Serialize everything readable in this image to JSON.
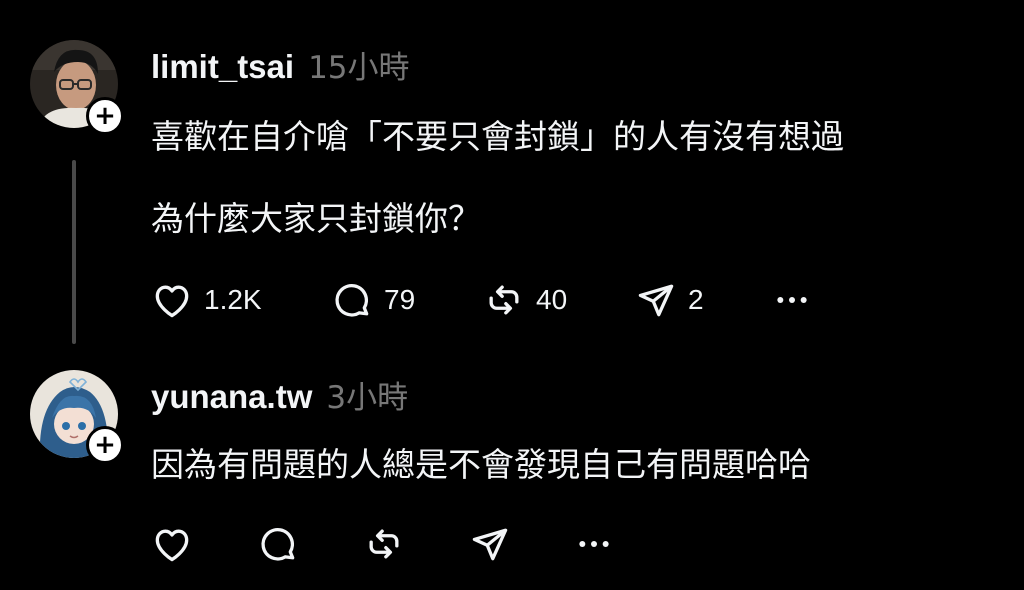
{
  "posts": [
    {
      "username": "limit_tsai",
      "time": "15小時",
      "lines": [
        "喜歡在自介嗆「不要只會封鎖」的人有沒有想過",
        "為什麼大家只封鎖你？"
      ],
      "counts": {
        "like": "1.2K",
        "reply": "79",
        "repost": "40",
        "share": "2"
      }
    },
    {
      "username": "yunana.tw",
      "time": "3小時",
      "lines": [
        "因為有問題的人總是不會發現自己有問題哈哈"
      ]
    }
  ],
  "follow_symbol": "+",
  "icons": [
    "heart-icon",
    "comment-icon",
    "repost-icon",
    "send-icon",
    "more-icon"
  ],
  "colors": {
    "background": "#000000",
    "text": "#f3f5f7",
    "muted": "#777777",
    "thread_line": "#4a4a4a"
  }
}
